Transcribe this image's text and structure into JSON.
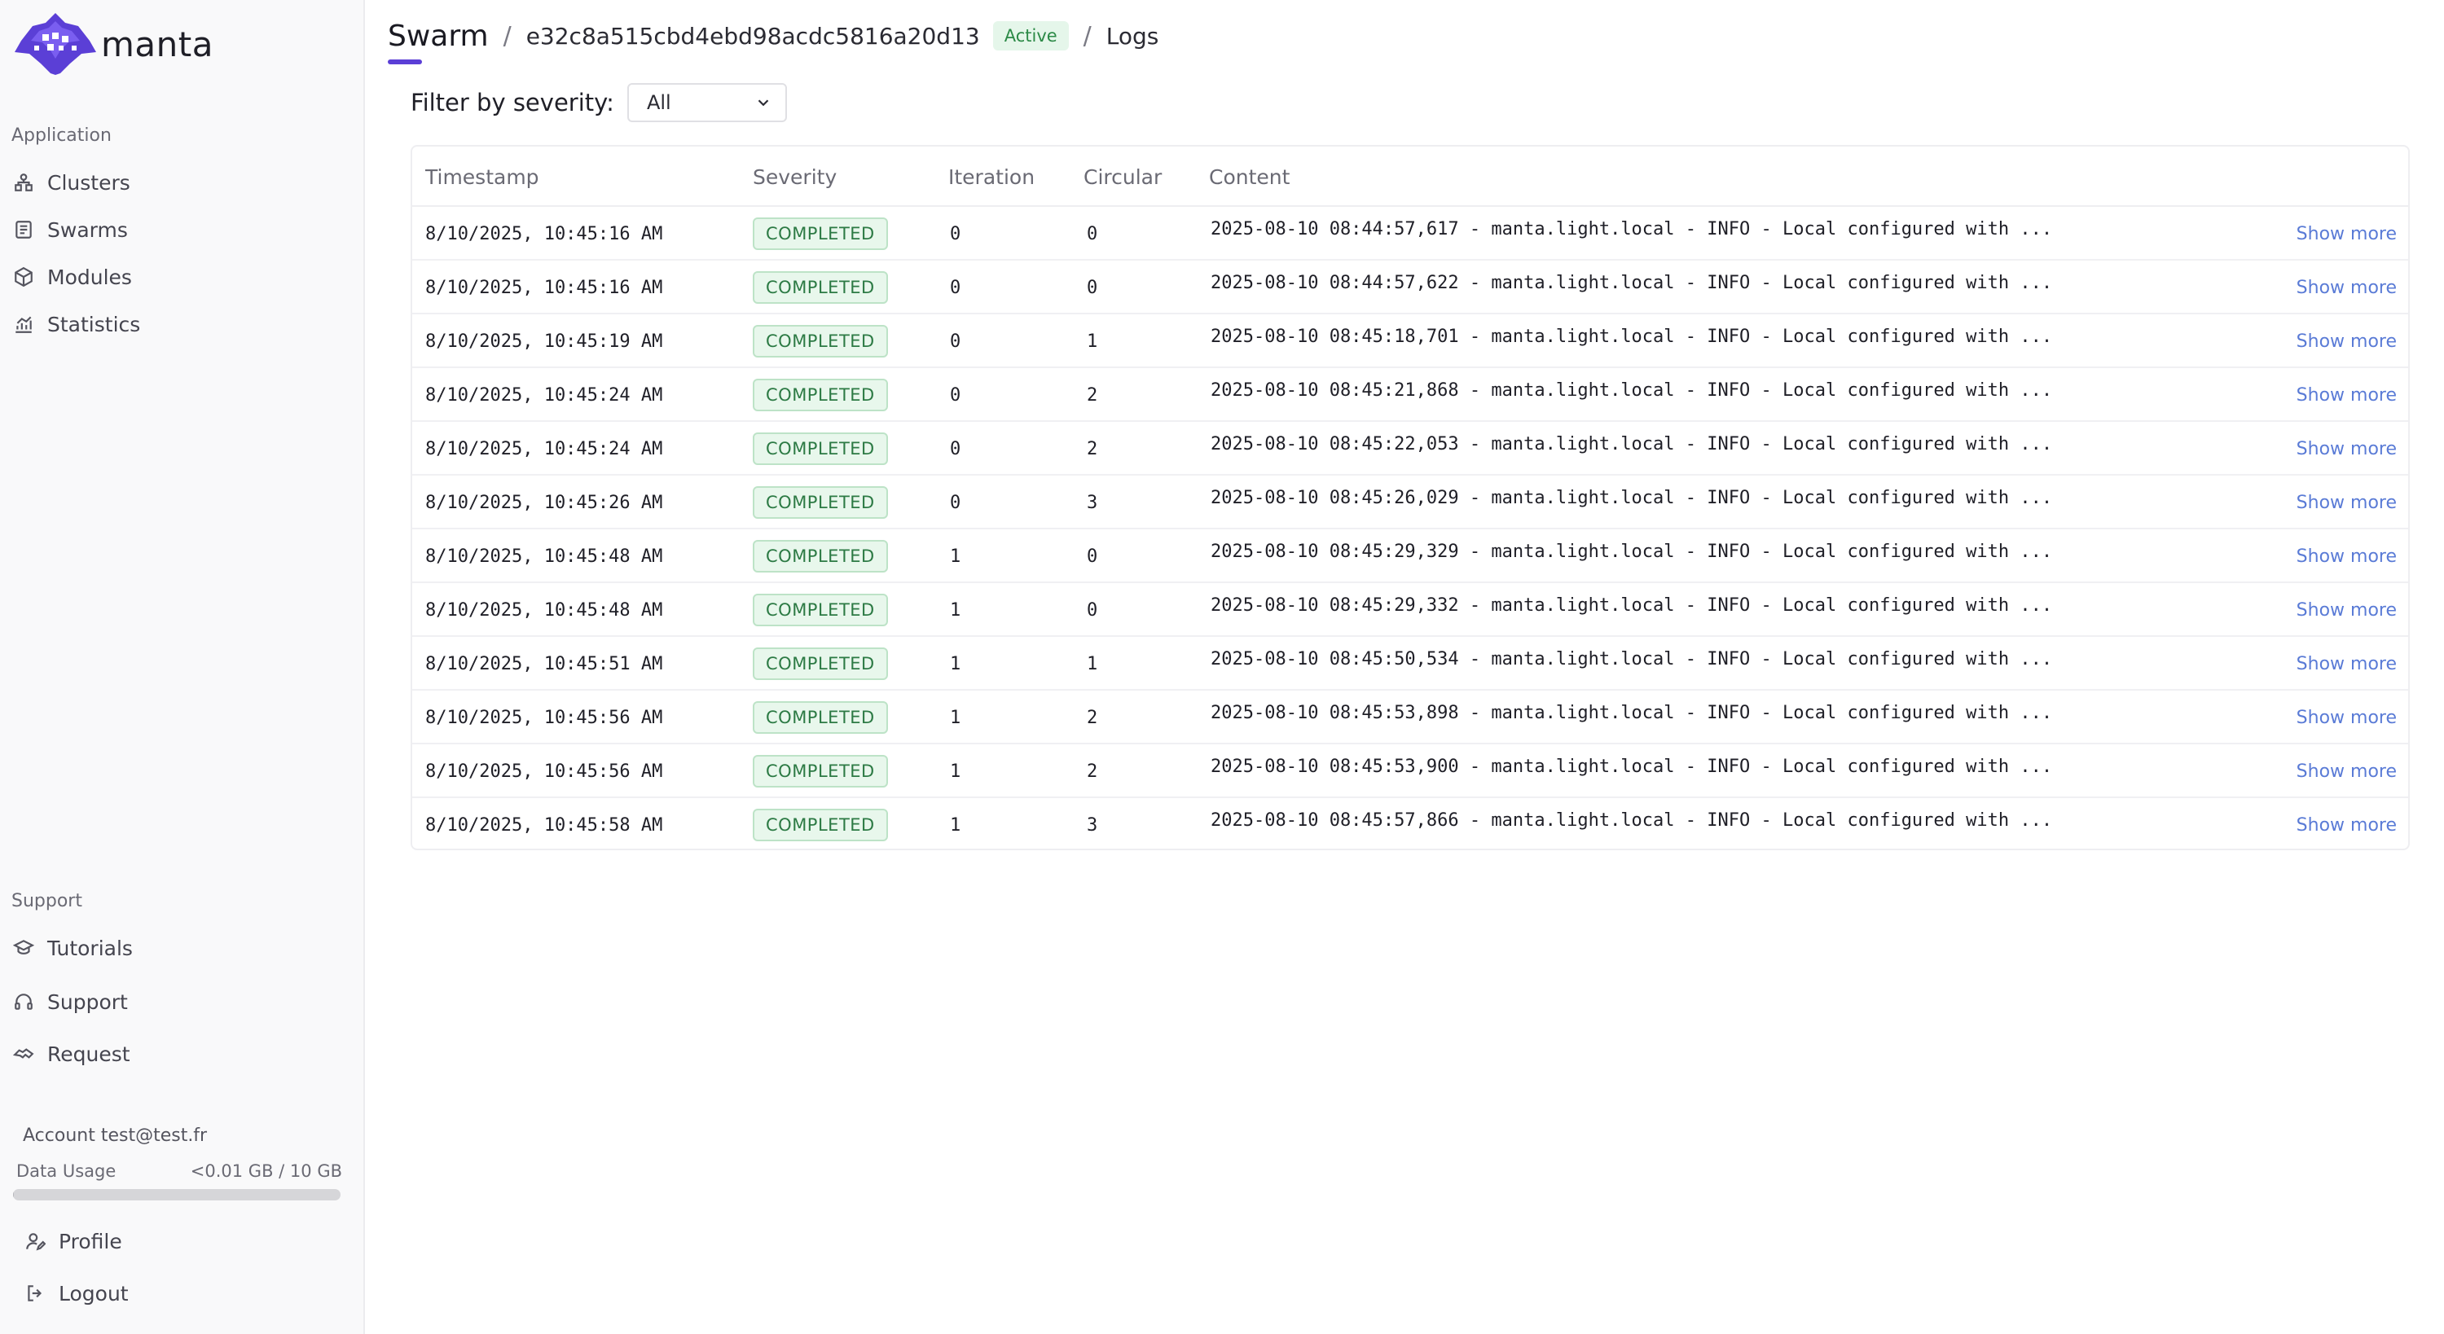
{
  "brand": {
    "name": "manta",
    "accent": "#5b3fd6"
  },
  "sidebar": {
    "application_label": "Application",
    "app_items": [
      {
        "label": "Clusters",
        "icon": "clusters-icon"
      },
      {
        "label": "Swarms",
        "icon": "swarms-icon"
      },
      {
        "label": "Modules",
        "icon": "modules-icon"
      },
      {
        "label": "Statistics",
        "icon": "statistics-icon"
      }
    ],
    "support_label": "Support",
    "support_items": [
      {
        "label": "Tutorials",
        "icon": "graduation-cap-icon"
      },
      {
        "label": "Support",
        "icon": "headset-icon"
      },
      {
        "label": "Request",
        "icon": "handshake-icon"
      }
    ],
    "account": "Account test@test.fr",
    "usage": {
      "label": "Data Usage",
      "value": "<0.01 GB / 10 GB",
      "fraction": 0.001
    },
    "footer_items": [
      {
        "label": "Profile",
        "icon": "user-pen-icon"
      },
      {
        "label": "Logout",
        "icon": "logout-icon"
      }
    ]
  },
  "breadcrumb": {
    "title": "Swarm",
    "separator": "/",
    "swarm_id": "e32c8a515cbd4ebd98acdc5816a20d13",
    "status": "Active",
    "page": "Logs"
  },
  "filter": {
    "label": "Filter by severity:",
    "selected": "All"
  },
  "table": {
    "headers": [
      "Timestamp",
      "Severity",
      "Iteration",
      "Circular",
      "Content"
    ],
    "action_label": "Show more",
    "rows": [
      {
        "timestamp": "8/10/2025, 10:45:16 AM",
        "severity": "COMPLETED",
        "iteration": "0",
        "circular": "0",
        "content": "2025-08-10 08:44:57,617 - manta.light.local - INFO - Local configured with ..."
      },
      {
        "timestamp": "8/10/2025, 10:45:16 AM",
        "severity": "COMPLETED",
        "iteration": "0",
        "circular": "0",
        "content": "2025-08-10 08:44:57,622 - manta.light.local - INFO - Local configured with ..."
      },
      {
        "timestamp": "8/10/2025, 10:45:19 AM",
        "severity": "COMPLETED",
        "iteration": "0",
        "circular": "1",
        "content": "2025-08-10 08:45:18,701 - manta.light.local - INFO - Local configured with ..."
      },
      {
        "timestamp": "8/10/2025, 10:45:24 AM",
        "severity": "COMPLETED",
        "iteration": "0",
        "circular": "2",
        "content": "2025-08-10 08:45:21,868 - manta.light.local - INFO - Local configured with ..."
      },
      {
        "timestamp": "8/10/2025, 10:45:24 AM",
        "severity": "COMPLETED",
        "iteration": "0",
        "circular": "2",
        "content": "2025-08-10 08:45:22,053 - manta.light.local - INFO - Local configured with ..."
      },
      {
        "timestamp": "8/10/2025, 10:45:26 AM",
        "severity": "COMPLETED",
        "iteration": "0",
        "circular": "3",
        "content": "2025-08-10 08:45:26,029 - manta.light.local - INFO - Local configured with ..."
      },
      {
        "timestamp": "8/10/2025, 10:45:48 AM",
        "severity": "COMPLETED",
        "iteration": "1",
        "circular": "0",
        "content": "2025-08-10 08:45:29,329 - manta.light.local - INFO - Local configured with ..."
      },
      {
        "timestamp": "8/10/2025, 10:45:48 AM",
        "severity": "COMPLETED",
        "iteration": "1",
        "circular": "0",
        "content": "2025-08-10 08:45:29,332 - manta.light.local - INFO - Local configured with ..."
      },
      {
        "timestamp": "8/10/2025, 10:45:51 AM",
        "severity": "COMPLETED",
        "iteration": "1",
        "circular": "1",
        "content": "2025-08-10 08:45:50,534 - manta.light.local - INFO - Local configured with ..."
      },
      {
        "timestamp": "8/10/2025, 10:45:56 AM",
        "severity": "COMPLETED",
        "iteration": "1",
        "circular": "2",
        "content": "2025-08-10 08:45:53,898 - manta.light.local - INFO - Local configured with ..."
      },
      {
        "timestamp": "8/10/2025, 10:45:56 AM",
        "severity": "COMPLETED",
        "iteration": "1",
        "circular": "2",
        "content": "2025-08-10 08:45:53,900 - manta.light.local - INFO - Local configured with ..."
      },
      {
        "timestamp": "8/10/2025, 10:45:58 AM",
        "severity": "COMPLETED",
        "iteration": "1",
        "circular": "3",
        "content": "2025-08-10 08:45:57,866 - manta.light.local - INFO - Local configured with ..."
      }
    ]
  }
}
